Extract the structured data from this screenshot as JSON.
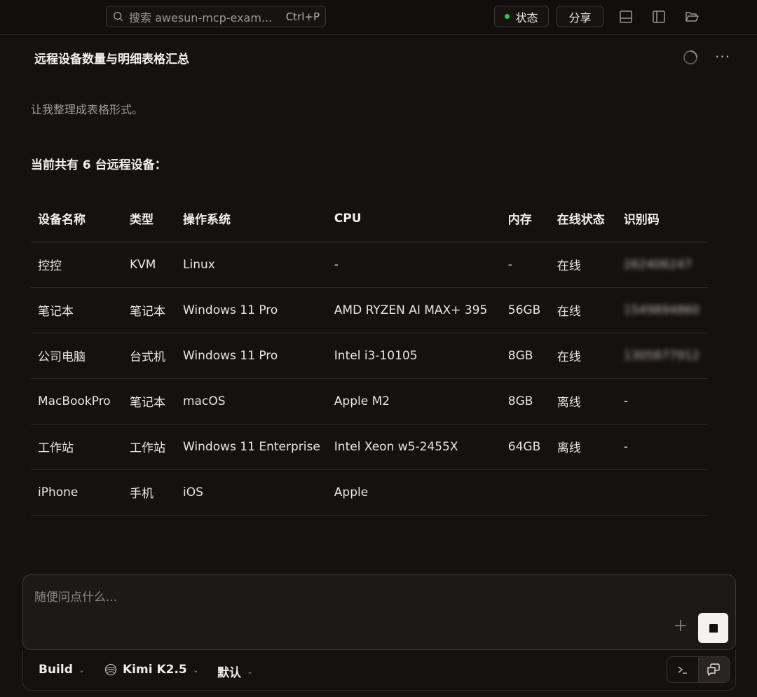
{
  "topbar": {
    "search_text": "搜索 awesun-mcp-exam...",
    "search_shortcut": "Ctrl+P",
    "status_label": "状态",
    "share_label": "分享"
  },
  "conversation": {
    "title": "远程设备数量与明细表格汇总",
    "intro": "让我整理成表格形式。",
    "count_line": "当前共有 6 台远程设备："
  },
  "table": {
    "headers": [
      "设备名称",
      "类型",
      "操作系统",
      "CPU",
      "内存",
      "在线状态",
      "识别码"
    ],
    "rows": [
      [
        "控控",
        "KVM",
        "Linux",
        "-",
        "-",
        "在线",
        "262406247"
      ],
      [
        "笔记本",
        "笔记本",
        "Windows 11 Pro",
        "AMD RYZEN AI MAX+ 395",
        "56GB",
        "在线",
        "1549894860"
      ],
      [
        "公司电脑",
        "台式机",
        "Windows 11 Pro",
        "Intel i3-10105",
        "8GB",
        "在线",
        "1305877912"
      ],
      [
        "MacBookPro",
        "笔记本",
        "macOS",
        "Apple M2",
        "8GB",
        "离线",
        "-"
      ],
      [
        "工作站",
        "工作站",
        "Windows 11 Enterprise",
        "Intel Xeon w5-2455X",
        "64GB",
        "离线",
        "-"
      ],
      [
        "iPhone",
        "手机",
        "iOS",
        "Apple",
        "",
        "",
        ""
      ]
    ]
  },
  "composer": {
    "placeholder": "随便问点什么...",
    "agent_label": "Build",
    "model_label": "Kimi K2.5",
    "variant_label": "默认"
  },
  "icons": {
    "search": "search-icon",
    "panel_bottom": "panel-bottom-icon",
    "panel_left": "panel-left-icon",
    "folder": "folder-open-icon",
    "spinner": "loading-spinner-icon",
    "more": "more-icon",
    "plus": "plus-icon",
    "stop": "stop-icon",
    "terminal": "terminal-icon",
    "chat": "chat-icon"
  },
  "colors": {
    "background": "#161111",
    "status_dot": "#27c93f",
    "stop_button": "#f4f1ee"
  }
}
